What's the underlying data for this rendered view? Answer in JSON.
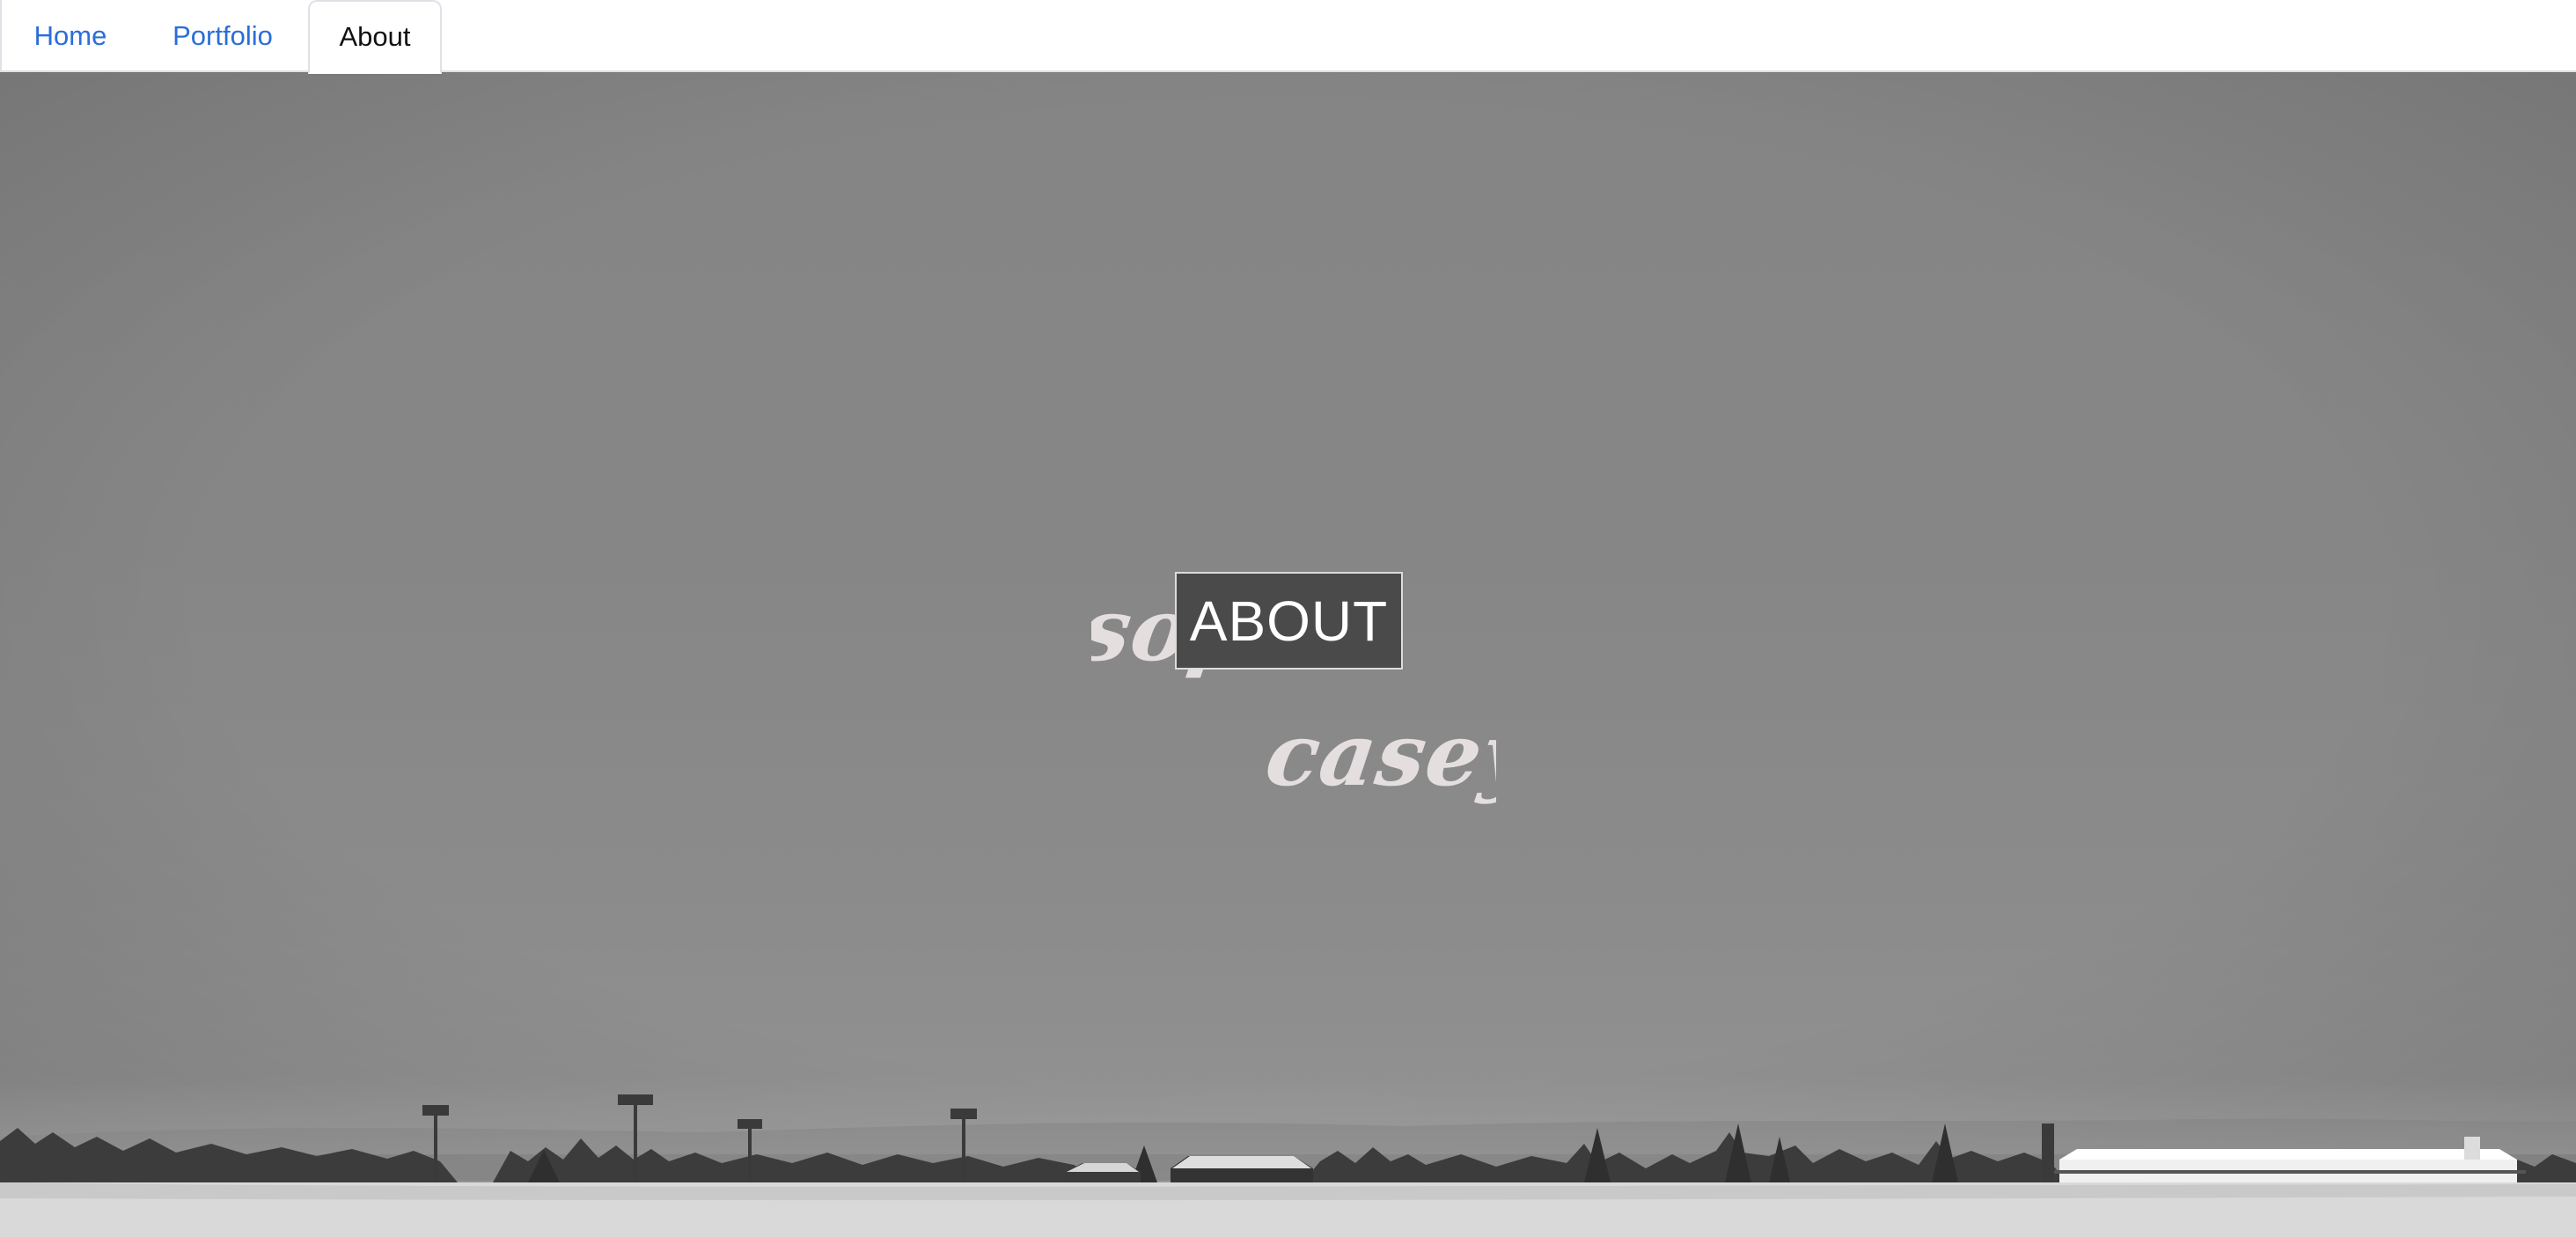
{
  "nav": {
    "tabs": [
      {
        "label": "Home",
        "active": false
      },
      {
        "label": "Portfolio",
        "active": false
      },
      {
        "label": "About",
        "active": true
      }
    ],
    "link_color": "#2a6ed8",
    "active_color": "#111111"
  },
  "hero": {
    "logo_word_top": "sophia",
    "logo_word_bottom": "casey",
    "title": "ABOUT",
    "title_box_color": "#4a4a4a",
    "script_color": "#e4dede"
  }
}
